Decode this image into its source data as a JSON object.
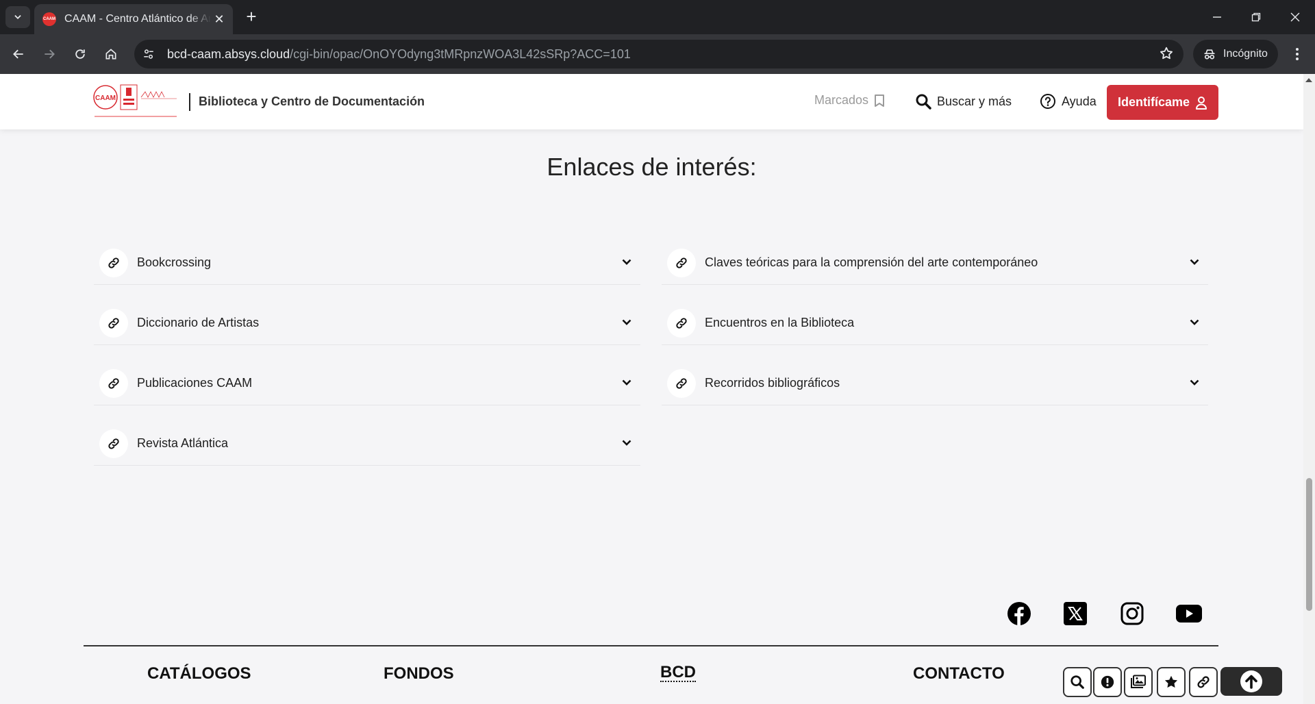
{
  "browser": {
    "tab_title": "CAAM - Centro Atlántico de Arte Moderno",
    "favicon_text": "CAAM",
    "url_host": "bcd-caam.absys.cloud",
    "url_path": "/cgi-bin/opac/OnOYOdyng3tMRpnzWOA3L42sSRp?ACC=101",
    "incognito_label": "Incógnito"
  },
  "header": {
    "site_title": "Biblioteca y Centro de Documentación",
    "marcados_label": "Marcados",
    "buscar_label": "Buscar y más",
    "ayuda_label": "Ayuda",
    "login_label": "Identifícame"
  },
  "links_section": {
    "title": "Enlaces de interés:",
    "left_items": [
      {
        "label": "Bookcrossing"
      },
      {
        "label": "Diccionario de Artistas"
      },
      {
        "label": "Publicaciones CAAM"
      },
      {
        "label": "Revista Atlántica"
      }
    ],
    "right_items": [
      {
        "label": "Claves teóricas para la comprensión del arte contemporáneo"
      },
      {
        "label": "Encuentros en la Biblioteca"
      },
      {
        "label": "Recorridos bibliográficos"
      }
    ]
  },
  "social": [
    "facebook-icon",
    "x-twitter-icon",
    "instagram-icon",
    "youtube-icon"
  ],
  "footer": {
    "catalogos": "CATÁLOGOS",
    "fondos": "FONDOS",
    "bcd": "BCD",
    "contacto": "CONTACTO"
  },
  "quick_buttons": [
    "search-icon",
    "alert-icon",
    "gallery-icon",
    "star-icon",
    "link-icon"
  ],
  "colors": {
    "accent": "#d0313a",
    "page_bg": "#f5f5f7",
    "chrome_dark": "#202124"
  }
}
